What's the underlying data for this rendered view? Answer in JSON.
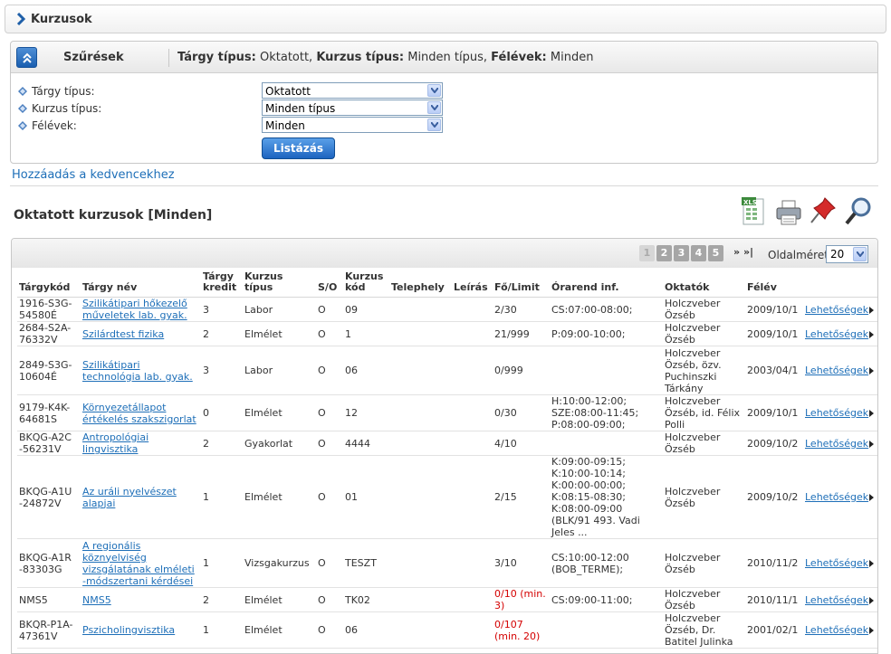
{
  "page": {
    "title": "Kurzusok"
  },
  "filters": {
    "title": "Szűrések",
    "summary": [
      {
        "label": "Tárgy típus:",
        "value": " Oktatott, "
      },
      {
        "label": "Kurzus típus:",
        "value": " Minden típus, "
      },
      {
        "label": "Félévek:",
        "value": " Minden"
      }
    ],
    "rows": [
      {
        "label": "Tárgy típus:",
        "value": "Oktatott"
      },
      {
        "label": "Kurzus típus:",
        "value": "Minden típus"
      },
      {
        "label": "Félévek:",
        "value": "Minden"
      }
    ],
    "list_button": "Listázás"
  },
  "favorites_link": "Hozzáadás a kedvencekhez",
  "section_title": "Oktatott kurzusok [Minden]",
  "toolbar_icons": [
    "excel-export-icon",
    "print-icon",
    "pin-icon",
    "search-zoom-icon"
  ],
  "pager": {
    "pages": [
      "1",
      "2",
      "3",
      "4",
      "5"
    ],
    "current": "1",
    "next": "»",
    "last": "»|",
    "page_size_label": "Oldalméret",
    "page_size": "20"
  },
  "table": {
    "headers": [
      "Tárgykód",
      "Tárgy név",
      "Tárgy kredit",
      "Kurzus típus",
      "S/O",
      "Kurzus kód",
      "Telephely",
      "Leírás",
      "Fő/Limit",
      "Órarend inf.",
      "Oktatók",
      "Félév",
      ""
    ],
    "rows": [
      {
        "code": "1916-S3G-54580É",
        "name": "Szilikátipari hőkezelő műveletek lab. gyak.",
        "credit": "3",
        "type": "Labor",
        "so": "O",
        "kod": "09",
        "site": "",
        "desc": "",
        "limit": "2/30",
        "limit_red": false,
        "schedule": "CS:07:00-08:00;",
        "teachers": "Holczveber Özséb",
        "semester": "2009/10/1",
        "options": "Lehetőségek"
      },
      {
        "code": "2684-S2A-76332V",
        "name": "Szilárdtest fizika",
        "credit": "2",
        "type": "Elmélet",
        "so": "O",
        "kod": "1",
        "site": "",
        "desc": "",
        "limit": "21/999",
        "limit_red": false,
        "schedule": "P:09:00-10:00;",
        "teachers": "Holczveber Özséb",
        "semester": "2009/10/1",
        "options": "Lehetőségek"
      },
      {
        "code": "2849-S3G-10604É",
        "name": "Szilikátipari technológia lab. gyak.",
        "credit": "3",
        "type": "Labor",
        "so": "O",
        "kod": "06",
        "site": "",
        "desc": "",
        "limit": "0/999",
        "limit_red": false,
        "schedule": "",
        "teachers": "Holczveber Özséb, özv. Puchinszki Tárkány",
        "semester": "2003/04/1",
        "options": "Lehetőségek"
      },
      {
        "code": "9179-K4K-64681S",
        "name": "Környezetállapot értékelés szakszigorlat",
        "credit": "0",
        "type": "Elmélet",
        "so": "O",
        "kod": "12",
        "site": "",
        "desc": "",
        "limit": "0/30",
        "limit_red": false,
        "schedule": "H:10:00-12:00; SZE:08:00-11:45; P:08:00-09:00;",
        "teachers": "Holczveber Özséb, id. Félix Polli",
        "semester": "2009/10/1",
        "options": "Lehetőségek"
      },
      {
        "code": "BKQG-A2C -56231V",
        "name": "Antropológiai lingvisztika",
        "credit": "2",
        "type": "Gyakorlat",
        "so": "O",
        "kod": "4444",
        "site": "",
        "desc": "",
        "limit": "4/10",
        "limit_red": false,
        "schedule": "",
        "teachers": "Holczveber Özséb",
        "semester": "2009/10/2",
        "options": "Lehetőségek"
      },
      {
        "code": "BKQG-A1U -24872V",
        "name": "Az uráli nyelvészet alapjai",
        "credit": "1",
        "type": "Elmélet",
        "so": "O",
        "kod": "01",
        "site": "",
        "desc": "",
        "limit": "2/15",
        "limit_red": false,
        "schedule": "K:09:00-09:15; K:10:00-10:14; K:00:00-00:00; K:08:15-08:30; K:08:00-09:00 (BLK/91 493. Vadi Jeles ...",
        "teachers": "Holczveber Özséb",
        "semester": "2009/10/2",
        "options": "Lehetőségek"
      },
      {
        "code": "BKQG-A1R -83303G",
        "name": "A regionális köznyelviség vizsgálatának elméleti -módszertani kérdései",
        "credit": "1",
        "type": "Vizsgakurzus",
        "so": "O",
        "kod": "TESZT",
        "site": "",
        "desc": "",
        "limit": "3/10",
        "limit_red": false,
        "schedule": "CS:10:00-12:00 (BOB_TERME);",
        "teachers": "Holczveber Özséb",
        "semester": "2010/11/2",
        "options": "Lehetőségek"
      },
      {
        "code": "NMS5",
        "name": "NMS5",
        "credit": "2",
        "type": "Elmélet",
        "so": "O",
        "kod": "TK02",
        "site": "",
        "desc": "",
        "limit": "0/10 (min. 3)",
        "limit_red": true,
        "schedule": "CS:09:00-11:00;",
        "teachers": "Holczveber Özséb",
        "semester": "2010/11/1",
        "options": "Lehetőségek"
      },
      {
        "code": "BKQR-P1A-47361V",
        "name": "Pszicholingvisztika",
        "credit": "1",
        "type": "Elmélet",
        "so": "O",
        "kod": "06",
        "site": "",
        "desc": "",
        "limit": "0/107 (min. 20)",
        "limit_red": true,
        "schedule": "",
        "teachers": "Holczveber Özséb, Dr. Batitel Julinka",
        "semester": "2001/02/1",
        "options": "Lehetőségek"
      }
    ]
  }
}
